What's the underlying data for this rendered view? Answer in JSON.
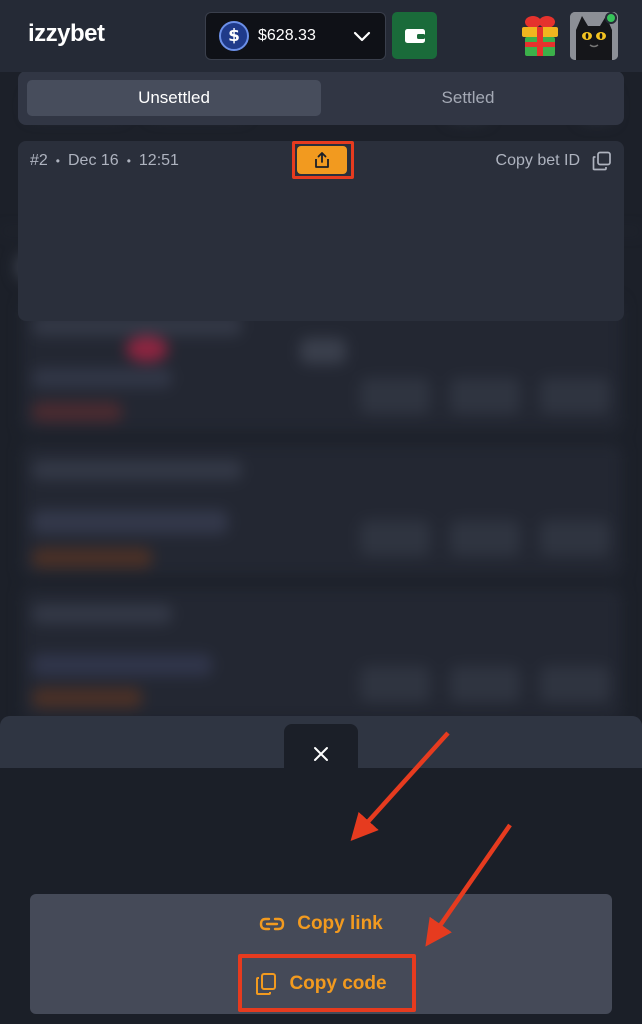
{
  "header": {
    "logo": "izzybet",
    "balance": "$628.33",
    "currency_icon": "dollar-coin-icon",
    "wallet_icon": "wallet-icon",
    "gift_icon": "gift-icon",
    "avatar_icon": "black-cat-avatar"
  },
  "bet_slip": {
    "close_icon": "close-icon",
    "tabs": [
      {
        "label": "Unsettled",
        "active": true
      },
      {
        "label": "Settled",
        "active": false
      }
    ],
    "bet": {
      "number": "#2",
      "date": "Dec 16",
      "time": "12:51",
      "copy_id_label": "Copy bet ID"
    },
    "share_menu": {
      "copy_link": "Copy link",
      "copy_code": "Copy code"
    }
  },
  "colors": {
    "accent": "#f29a1f",
    "highlight": "#e63b1f",
    "online": "#37c45a",
    "wallet": "#1a6b3a"
  }
}
